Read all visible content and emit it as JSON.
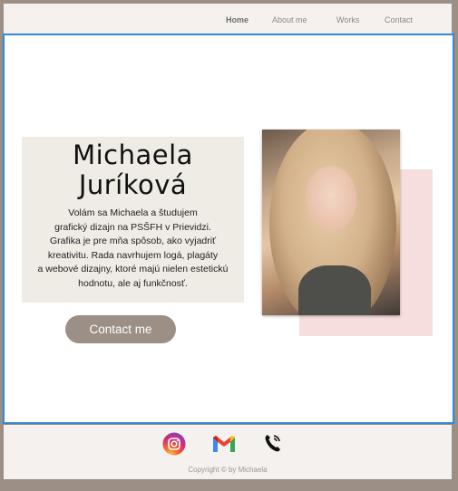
{
  "nav": {
    "items": [
      {
        "label": "Home",
        "active": true
      },
      {
        "label": "About me",
        "active": false
      },
      {
        "label": "Works",
        "active": false
      },
      {
        "label": "Contact",
        "active": false
      }
    ]
  },
  "hero": {
    "name_line1": "Michaela",
    "name_line2": "Juríková",
    "bio_lines": [
      "Volám sa Michaela a študujem",
      "grafický dizajn na PSŠFH v Prievidzi.",
      "Grafika je pre mňa spôsob, ako vyjadriť",
      "kreativitu. Rada navrhujem logá, plagáty",
      "a webové dizajny, ktoré majú nielen estetickú",
      "hodnotu, ale aj funkčnosť."
    ],
    "contact_button": "Contact me"
  },
  "footer": {
    "icons": [
      "instagram-icon",
      "gmail-icon",
      "phone-icon"
    ],
    "copyright": "Copyright © by Michaela"
  },
  "colors": {
    "background": "#9b8f86",
    "accent_pink": "#f6dede",
    "box": "#efebe5",
    "button": "#9b8f86",
    "selection_border": "#2f8ad8"
  }
}
